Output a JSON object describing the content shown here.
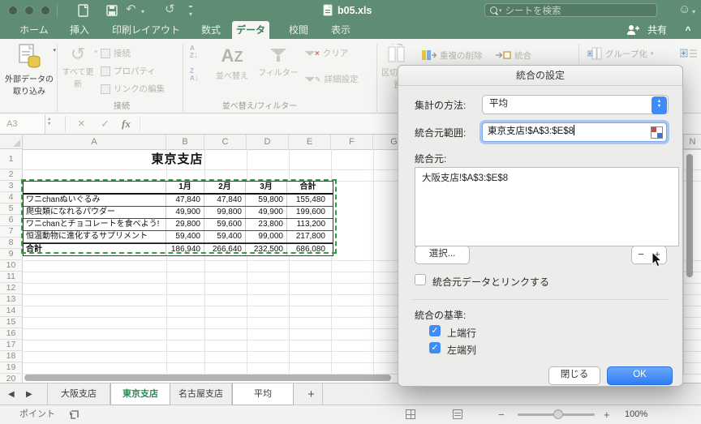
{
  "window": {
    "title": "b05.xls",
    "search_placeholder": "シートを検索"
  },
  "ribbon": {
    "tabs": [
      "ホーム",
      "挿入",
      "印刷レイアウト",
      "数式",
      "データ",
      "校閲",
      "表示"
    ],
    "active_tab": "データ",
    "share_label": "共有",
    "groups": {
      "external_button": "外部データの取り込み",
      "refresh_button": "すべて更新",
      "connection_items": [
        "接続",
        "プロパティ",
        "リンクの編集"
      ],
      "connections_label": "接続",
      "sort_button": "並べ替え",
      "filter_button": "フィルター",
      "clear_button": "クリア",
      "advanced_button": "詳細設定",
      "sort_filter_label": "並べ替え/フィルター",
      "text_to_columns_button": "区切り位置",
      "remove_duplicates_button": "重複の削除",
      "consolidate_button": "統合",
      "group_button": "グループ化"
    }
  },
  "formula_bar": {
    "name_box": "A3",
    "fx_label": "fx"
  },
  "sheet": {
    "title": "東京支店",
    "columns": [
      "A",
      "B",
      "C",
      "D",
      "E",
      "F",
      "G"
    ],
    "right_column": "N",
    "row_numbers": [
      "1",
      "2",
      "3",
      "4",
      "5",
      "6",
      "7",
      "8",
      "9",
      "10",
      "11",
      "12",
      "13",
      "14",
      "15",
      "16",
      "17",
      "18",
      "19",
      "20"
    ],
    "table": {
      "headers": [
        "1月",
        "2月",
        "3月",
        "合計"
      ],
      "rows": [
        {
          "label": "ワニchanぬいぐるみ",
          "values": [
            "47,840",
            "47,840",
            "59,800",
            "155,480"
          ]
        },
        {
          "label": "爬虫類になれるパウダー",
          "values": [
            "49,900",
            "99,800",
            "49,900",
            "199,600"
          ]
        },
        {
          "label": "ワニchanとチョコレートを食べよう!",
          "values": [
            "29,800",
            "59,600",
            "23,800",
            "113,200"
          ]
        },
        {
          "label": "恒温動物に進化するサプリメント",
          "values": [
            "59,400",
            "59,400",
            "99,000",
            "217,800"
          ]
        },
        {
          "label": "合計",
          "values": [
            "186,940",
            "266,640",
            "232,500",
            "686,080"
          ]
        }
      ]
    }
  },
  "dialog": {
    "title": "統合の設定",
    "function_label": "集計の方法:",
    "function_value": "平均",
    "range_label": "統合元範囲:",
    "range_value": "東京支店!$A$3:$E$8",
    "sources_label": "統合元:",
    "sources": [
      "大阪支店!$A$3:$E$8"
    ],
    "select_button": "選択...",
    "remove_button": "−",
    "add_button": "+",
    "link_checkbox": "統合元データとリンクする",
    "basis_label": "統合の基準:",
    "top_row": "上端行",
    "left_column": "左端列",
    "close_button": "閉じる",
    "ok_button": "OK"
  },
  "sheet_tabs": {
    "tabs": [
      "大阪支店",
      "東京支店",
      "名古屋支店",
      "平均"
    ],
    "add_label": "+"
  },
  "status_bar": {
    "mode": "ポイント",
    "zoom": "100%"
  },
  "icons": {
    "caret_down": "▾",
    "undo": "↶",
    "redo": "↺",
    "cancel": "×",
    "enter": "✓",
    "up_down": "▲▼",
    "prev": "◀",
    "next": "▶",
    "smiley": "☺",
    "chevron_up": "^",
    "minus": "−",
    "plus": "+",
    "down": "▼",
    "check": "✓"
  }
}
